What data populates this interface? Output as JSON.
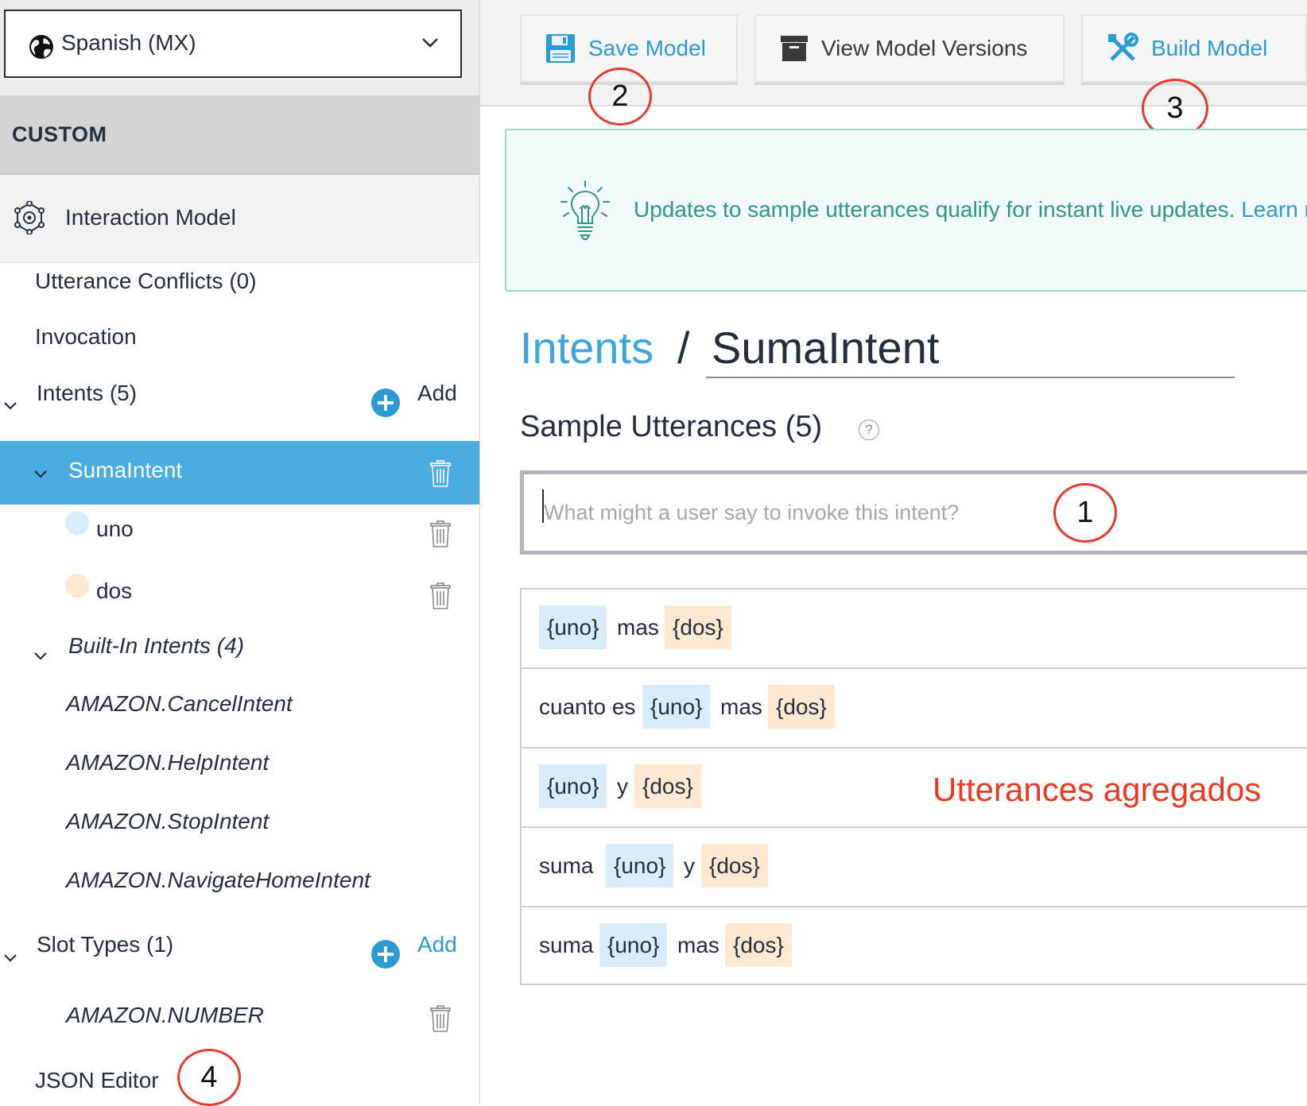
{
  "sidebar": {
    "locale": "Spanish (MX)",
    "section_header": "CUSTOM",
    "interaction_model": "Interaction Model",
    "items": {
      "utterance_conflicts": "Utterance Conflicts (0)",
      "invocation": "Invocation",
      "intents": "Intents (5)",
      "intents_add": "Add",
      "selected_intent": "SumaIntent",
      "slots": [
        "uno",
        "dos"
      ],
      "builtin_header": "Built-In Intents (4)",
      "builtin": [
        "AMAZON.CancelIntent",
        "AMAZON.HelpIntent",
        "AMAZON.StopIntent",
        "AMAZON.NavigateHomeIntent"
      ],
      "slot_types": "Slot Types (1)",
      "slot_types_add": "Add",
      "slot_type_items": [
        "AMAZON.NUMBER"
      ],
      "json_editor": "JSON Editor"
    }
  },
  "toolbar": {
    "save": "Save Model",
    "versions": "View Model Versions",
    "build": "Build Model"
  },
  "banner": {
    "text": "Updates to sample utterances qualify for instant live updates.",
    "link": "Learn m"
  },
  "breadcrumb": {
    "parent": "Intents",
    "separator": "/",
    "current": "SumaIntent"
  },
  "utterances": {
    "title": "Sample Utterances (5)",
    "help": "?",
    "placeholder": "What might a user say to invoke this intent?",
    "rows": [
      [
        "{uno}",
        "mas",
        "{dos}"
      ],
      [
        "cuanto es",
        "{uno}",
        "mas",
        "{dos}"
      ],
      [
        "{uno}",
        "y",
        "{dos}"
      ],
      [
        "suma",
        "{uno}",
        "y",
        "{dos}"
      ],
      [
        "suma",
        "{uno}",
        "mas",
        "{dos}"
      ]
    ]
  },
  "annotations": {
    "markers": [
      "1",
      "2",
      "3",
      "4"
    ],
    "text": "Utterances agregados"
  },
  "colors": {
    "selected": "#4aace0",
    "link": "#3aa6dd",
    "slot_uno": "#d8ecfb",
    "slot_dos": "#fde9d2",
    "annotation": "#ea3a22",
    "banner_text": "#2b9a83"
  }
}
